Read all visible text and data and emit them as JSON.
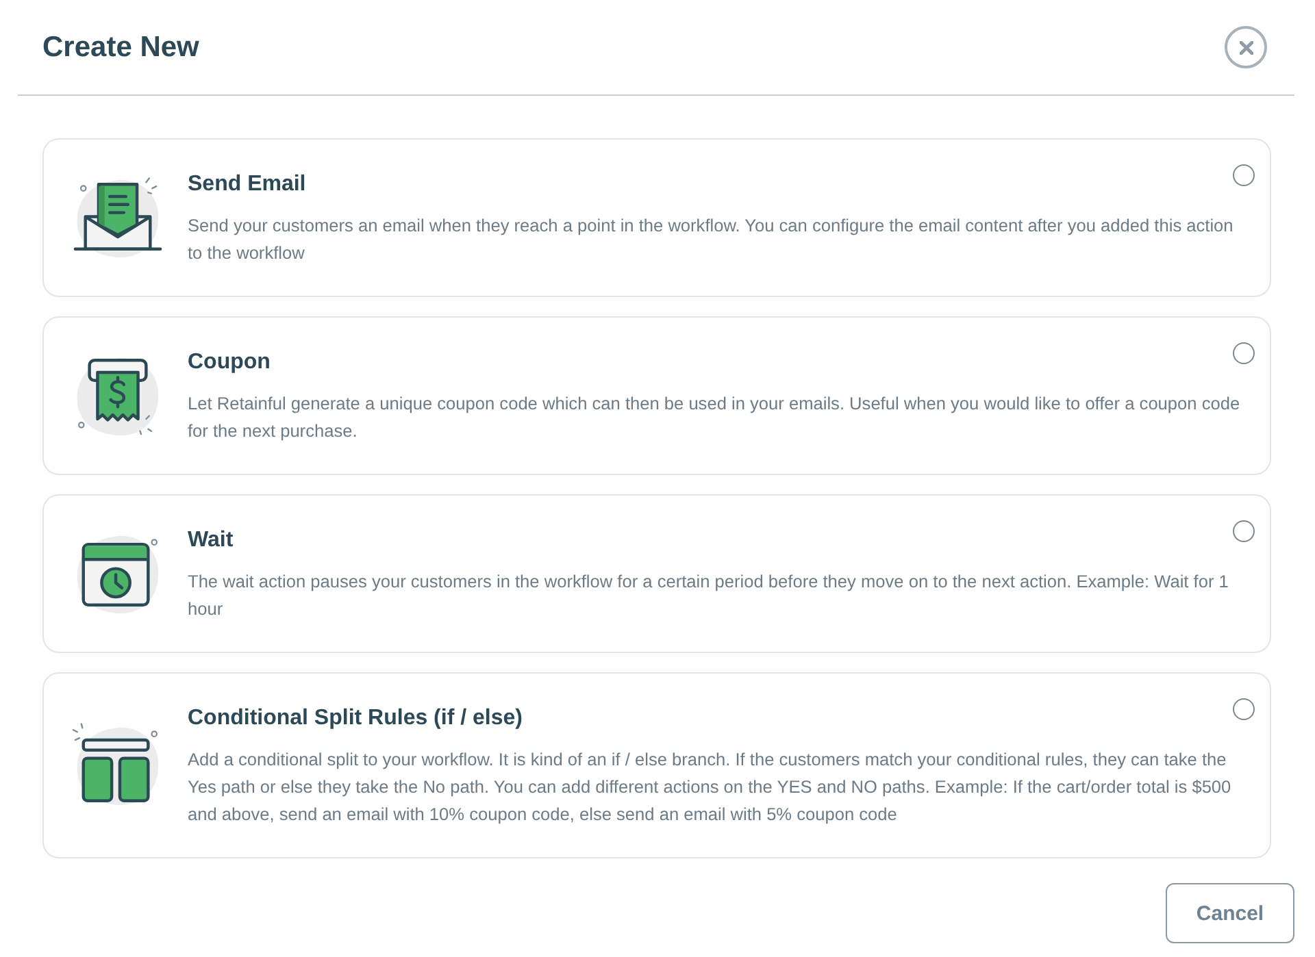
{
  "dialog": {
    "title": "Create New"
  },
  "options": [
    {
      "kind": "email",
      "title": "Send Email",
      "description": "Send your customers an email when they reach a point in the workflow. You can configure the email content after you added this action to the workflow",
      "selected": false
    },
    {
      "kind": "coupon",
      "title": "Coupon",
      "description": "Let Retainful generate a unique coupon code which can then be used in your emails. Useful when you would like to offer a coupon code for the next purchase.",
      "selected": false
    },
    {
      "kind": "wait",
      "title": "Wait",
      "description": "The wait action pauses your customers in the workflow for a certain period before they move on to the next action. Example: Wait for 1 hour",
      "selected": false
    },
    {
      "kind": "split",
      "title": "Conditional Split Rules (if / else)",
      "description": "Add a conditional split to your workflow. It is kind of an if / else branch. If the customers match your conditional rules, they can take the Yes path or else they take the No path. You can add different actions on the YES and NO paths. Example: If the cart/order total is $500 and above, send an email with 10% coupon code, else send an email with 5% coupon code",
      "selected": false
    }
  ],
  "footer": {
    "cancel_button": "Cancel"
  }
}
